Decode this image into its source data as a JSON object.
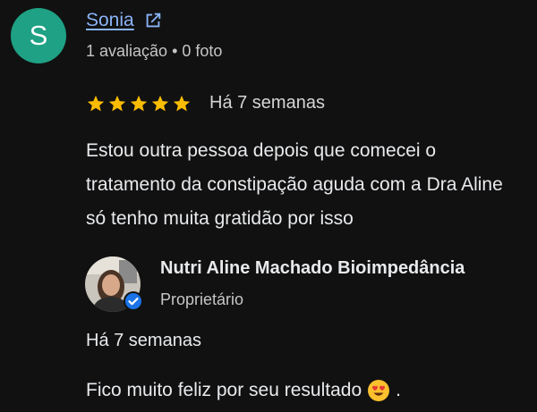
{
  "reviewer": {
    "initial": "S",
    "name": "Sonia",
    "meta": "1 avaliação • 0 foto",
    "avatar_color": "#1ea184",
    "link_icon": "external-link-icon"
  },
  "review": {
    "rating": 5,
    "rating_max": 5,
    "date": "Há 7 semanas",
    "text": "Estou outra pessoa depois que comecei o tratamento da constipação aguda com a Dra Aline só tenho muita gratidão por isso"
  },
  "owner_reply": {
    "name": "Nutri Aline Machado Bioimpedância",
    "role": "Proprietário",
    "verified_icon": "verified-check-icon",
    "date": "Há 7 semanas",
    "text": "Fico muito feliz por seu resultado",
    "emoji_icon": "heart-eyes-emoji-icon",
    "text_end": "."
  },
  "colors": {
    "background": "#111111",
    "link": "#8ab4f8",
    "star": "#fbbc04",
    "verified": "#1a73e8"
  }
}
